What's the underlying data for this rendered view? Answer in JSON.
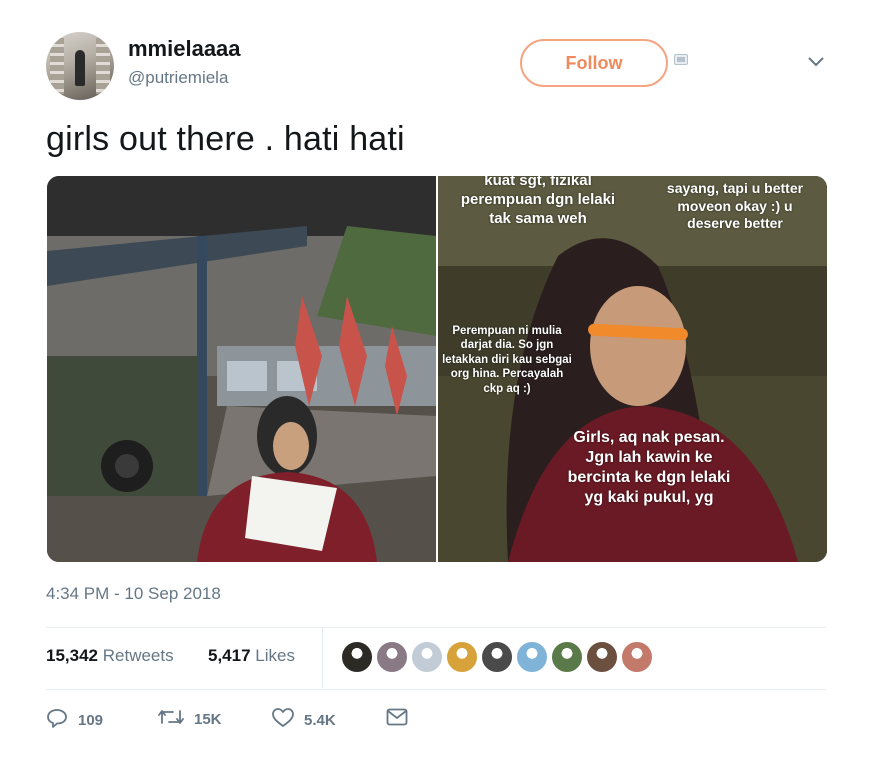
{
  "user": {
    "display_name": "mmielaaaa",
    "handle": "@putriemiela",
    "avatar_icon": "profile-photo"
  },
  "header": {
    "follow_label": "Follow",
    "menu_icon": "chevron-down-icon"
  },
  "tweet": {
    "text": "girls out there . hati hati",
    "timestamp": "4:34 PM - 10 Sep 2018"
  },
  "media": {
    "right_image": {
      "captions": [
        "kuat sgt, fizikal perempuan dgn lelaki tak sama weh",
        "sayang, tapi u better moveon okay :) u deserve better",
        "Perempuan ni mulia darjat dia. So jgn letakkan diri kau sebgai org hina. Percayalah ckp aq :)",
        "Girls, aq nak pesan. Jgn lah kawin ke bercinta ke dgn lelaki yg kaki pukul, yg"
      ]
    }
  },
  "stats": {
    "retweets_count": "15,342",
    "retweets_label": "Retweets",
    "likes_count": "5,417",
    "likes_label": "Likes"
  },
  "likers": [
    {
      "color": "#2b2a24"
    },
    {
      "color": "#8a7a86"
    },
    {
      "color": "#c2ccd6"
    },
    {
      "color": "#d8a23a"
    },
    {
      "color": "#4a4a4a"
    },
    {
      "color": "#7fb4d8"
    },
    {
      "color": "#5a7a4a"
    },
    {
      "color": "#6b4f3f"
    },
    {
      "color": "#c47a6a"
    }
  ],
  "actions": {
    "reply_count": "109",
    "retweet_count": "15K",
    "like_count": "5.4K"
  },
  "colors": {
    "follow_accent": "#f08a5d",
    "muted": "#657786",
    "text": "#14171a"
  }
}
